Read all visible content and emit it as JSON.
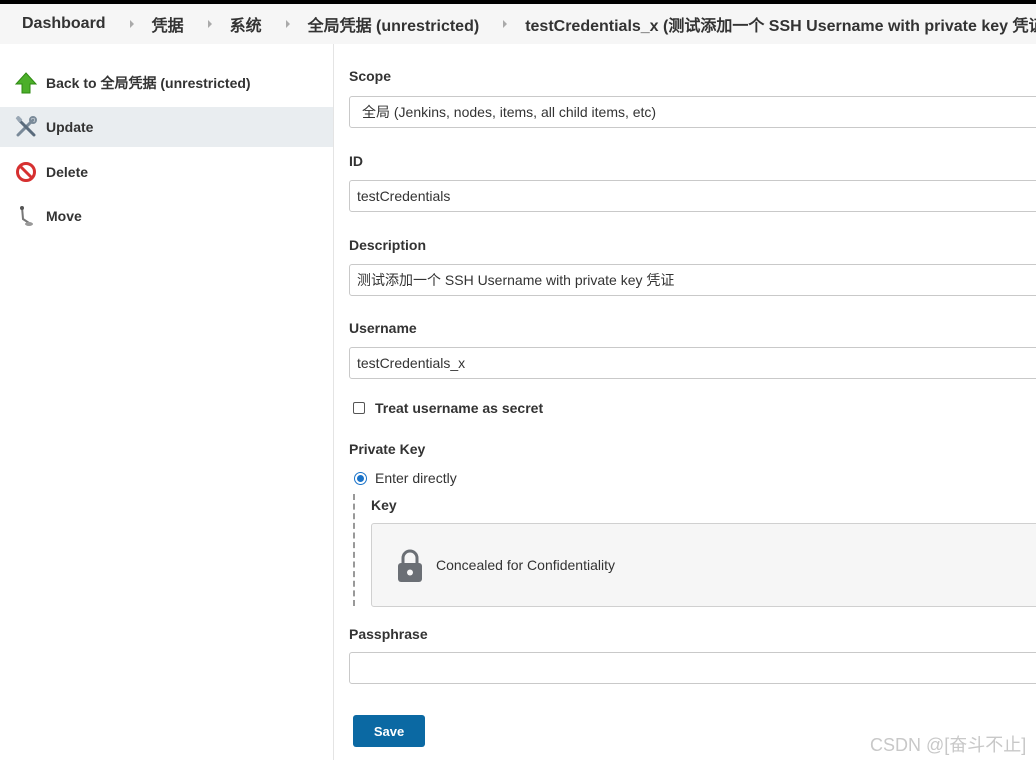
{
  "breadcrumb": [
    "Dashboard",
    "凭据",
    "系统",
    "全局凭据 (unrestricted)",
    "testCredentials_x (测试添加一个 SSH Username with private key 凭证"
  ],
  "sidebar": {
    "items": [
      {
        "label": "Back to 全局凭据 (unrestricted)",
        "icon": "up-arrow-icon"
      },
      {
        "label": "Update",
        "icon": "tools-icon"
      },
      {
        "label": "Delete",
        "icon": "no-entry-icon"
      },
      {
        "label": "Move",
        "icon": "move-icon"
      }
    ]
  },
  "form": {
    "scope_label": "Scope",
    "scope_value": "全局 (Jenkins, nodes, items, all child items, etc)",
    "id_label": "ID",
    "id_value": "testCredentials",
    "description_label": "Description",
    "description_value": "测试添加一个 SSH Username with private key 凭证",
    "username_label": "Username",
    "username_value": "testCredentials_x",
    "treat_secret_label": "Treat username as secret",
    "treat_secret_checked": false,
    "private_key_label": "Private Key",
    "enter_directly_label": "Enter directly",
    "enter_directly_selected": true,
    "key_label": "Key",
    "concealed_text": "Concealed for Confidentiality",
    "passphrase_label": "Passphrase",
    "passphrase_value": "",
    "save_label": "Save"
  },
  "watermark": "CSDN @[奋斗不止]",
  "colors": {
    "accent": "#0b69a3",
    "radio": "#1a73c9",
    "active_bg": "#e9edf0"
  }
}
